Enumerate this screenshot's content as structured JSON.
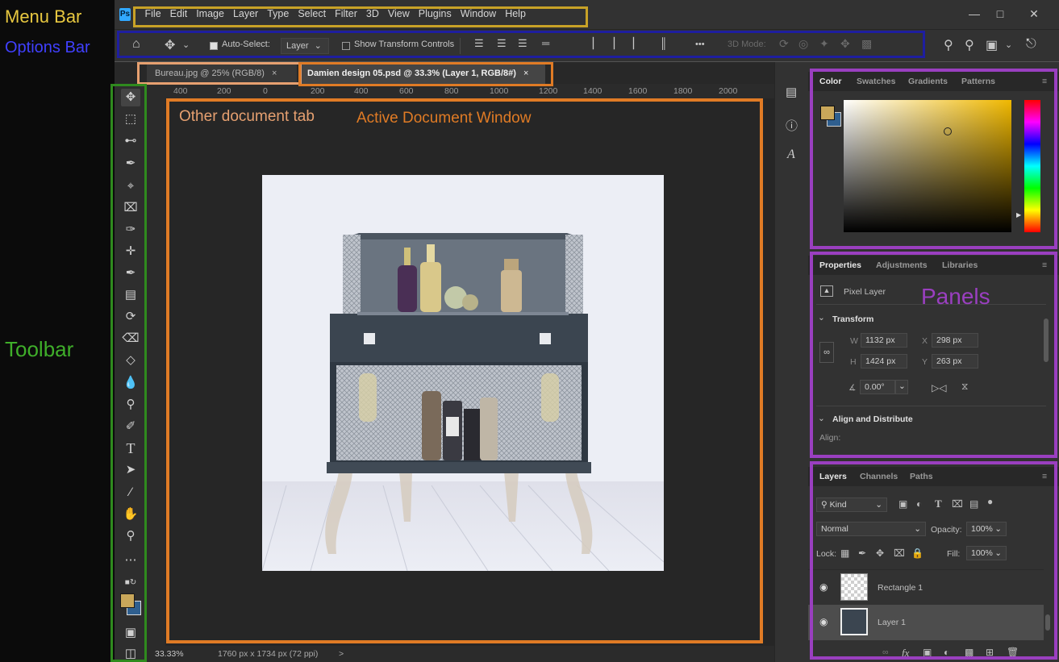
{
  "annotations": {
    "menu_bar": "Menu Bar",
    "options_bar": "Options Bar",
    "toolbar": "Toolbar",
    "other_document_tab": "Other document tab",
    "active_document_window": "Active Document Window",
    "panels": "Panels"
  },
  "colors": {
    "menu_box": "#c8a227",
    "options_box": "#1e1ea0",
    "toolbar_box": "#2f8a1e",
    "tab_box": "#e07b25",
    "panels_box": "#9a3fc0"
  },
  "menu": [
    "File",
    "Edit",
    "Image",
    "Layer",
    "Type",
    "Select",
    "Filter",
    "3D",
    "View",
    "Plugins",
    "Window",
    "Help"
  ],
  "options_bar": {
    "auto_select_label": "Auto-Select:",
    "auto_select_value": "Layer",
    "show_transform_label": "Show Transform Controls",
    "more": "•••",
    "mode_3d": "3D Mode:"
  },
  "tabs": [
    {
      "label": "Bureau.jpg @ 25% (RGB/8)",
      "close": "×"
    },
    {
      "label": "Damien design 05.psd @ 33.3% (Layer 1, RGB/8#)",
      "close": "×"
    }
  ],
  "ruler_ticks": [
    "400",
    "200",
    "0",
    "200",
    "400",
    "600",
    "800",
    "1000",
    "1200",
    "1400",
    "1600",
    "1800",
    "2000"
  ],
  "status": {
    "zoom": "33.33%",
    "doc_size": "1760 px x 1734 px (72 ppi)",
    "arrow": ">"
  },
  "color_panel": {
    "tabs": [
      "Color",
      "Swatches",
      "Gradients",
      "Patterns"
    ],
    "foreground": "#c9a75a",
    "background": "#2f5f8f"
  },
  "properties_panel": {
    "tabs": [
      "Properties",
      "Adjustments",
      "Libraries"
    ],
    "layer_type": "Pixel Layer",
    "transform_header": "Transform",
    "w_label": "W",
    "w_value": "1132 px",
    "x_label": "X",
    "x_value": "298 px",
    "h_label": "H",
    "h_value": "1424 px",
    "y_label": "Y",
    "y_value": "263 px",
    "angle_value": "0.00°",
    "align_header": "Align and Distribute",
    "align_label": "Align:"
  },
  "layers_panel": {
    "tabs": [
      "Layers",
      "Channels",
      "Paths"
    ],
    "kind": "Kind",
    "blend_mode": "Normal",
    "opacity_label": "Opacity:",
    "opacity_value": "100%",
    "lock_label": "Lock:",
    "fill_label": "Fill:",
    "fill_value": "100%",
    "layers": [
      {
        "name": "Rectangle 1"
      },
      {
        "name": "Layer 1"
      }
    ]
  }
}
